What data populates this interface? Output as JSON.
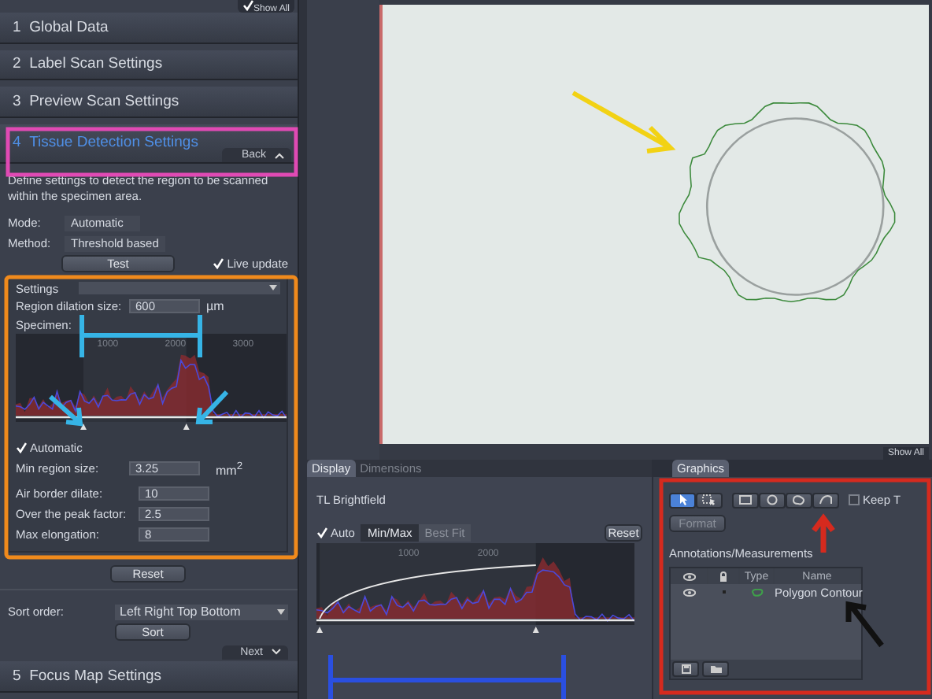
{
  "left_panel": {
    "show_all": {
      "label": "Show All",
      "checked": true
    },
    "sections": [
      {
        "number": "1",
        "title": "Global Data",
        "selected": false
      },
      {
        "number": "2",
        "title": "Label Scan Settings",
        "selected": false
      },
      {
        "number": "3",
        "title": "Preview Scan Settings",
        "selected": false
      },
      {
        "number": "4",
        "title": "Tissue Detection Settings",
        "selected": true
      }
    ],
    "back_tab": "Back",
    "description": "Define settings to detect the region to be scanned within the specimen area.",
    "props": [
      {
        "label": "Mode:",
        "value": "Automatic"
      },
      {
        "label": "Method:",
        "value": "Threshold based"
      }
    ],
    "test_button": "Test",
    "live_update": {
      "label": "Live update",
      "checked": true
    },
    "settings": {
      "title": "Settings",
      "dilation": {
        "label": "Region dilation size:",
        "value": "600",
        "unit": "µm"
      },
      "specimen_label": "Specimen:",
      "histogram_ticks": [
        "1000",
        "2000",
        "3000"
      ],
      "automatic": {
        "label": "Automatic",
        "checked": true
      },
      "min_region": {
        "label": "Min region size:",
        "value": "3.25",
        "unit": "mm$^{2}$"
      },
      "fields": [
        {
          "label": "Air border dilate:",
          "value": "10"
        },
        {
          "label": "Over the peak factor:",
          "value": "2.5"
        },
        {
          "label": "Max elongation:",
          "value": "8"
        }
      ]
    },
    "reset_button": "Reset",
    "sort": {
      "label": "Sort order:",
      "value": "Left Right Top Bottom",
      "button": "Sort"
    },
    "next_tab": "Next",
    "next_section": {
      "number": "5",
      "title": "Focus Map Settings"
    }
  },
  "image_view": {
    "show_all": "Show All"
  },
  "display_panel": {
    "tabs": [
      {
        "label": "Display",
        "selected": true
      },
      {
        "label": "Dimensions",
        "selected": false
      }
    ],
    "channel": "TL Brightfield",
    "auto": {
      "label": "Auto",
      "checked": true
    },
    "modes": [
      {
        "label": "Min/Max",
        "selected": true
      },
      {
        "label": "Best Fit",
        "selected": false
      }
    ],
    "reset_button": "Reset",
    "histogram_ticks": [
      "1000",
      "2000"
    ]
  },
  "graphics_panel": {
    "tab": "Graphics",
    "tools": [
      {
        "kind": "pointer",
        "selected": true
      },
      {
        "kind": "select",
        "selected": false
      }
    ],
    "shapes": [
      {
        "kind": "rectangle"
      },
      {
        "kind": "circle"
      },
      {
        "kind": "contour"
      },
      {
        "kind": "curve"
      }
    ],
    "keep_tool": {
      "label": "Keep T",
      "checked": false
    },
    "format_button": {
      "label": "Format",
      "disabled": true
    },
    "list_title": "Annotations/Measurements",
    "columns": [
      "Type",
      "Name"
    ],
    "rows": [
      {
        "name": "Polygon Contour",
        "visible": true
      }
    ]
  }
}
